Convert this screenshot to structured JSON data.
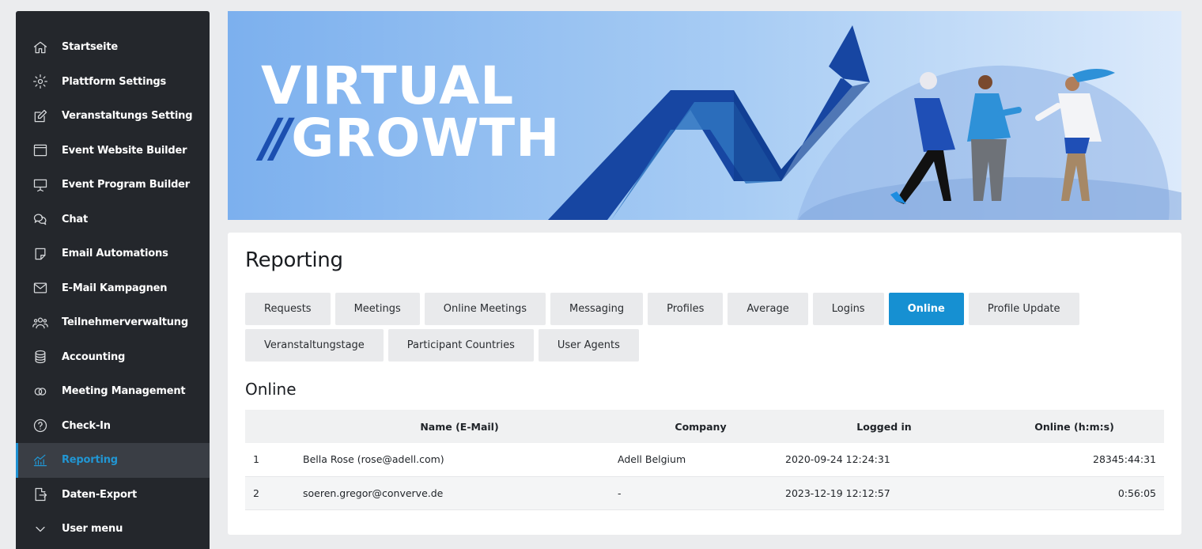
{
  "sidebar": {
    "items": [
      {
        "label": "Startseite",
        "icon": "home-icon"
      },
      {
        "label": "Plattform Settings",
        "icon": "gear-icon"
      },
      {
        "label": "Veranstaltungs Setting",
        "icon": "edit-icon"
      },
      {
        "label": "Event Website Builder",
        "icon": "browser-window-icon"
      },
      {
        "label": "Event Program Builder",
        "icon": "presentation-icon"
      },
      {
        "label": "Chat",
        "icon": "chat-bubbles-icon"
      },
      {
        "label": "Email Automations",
        "icon": "note-icon"
      },
      {
        "label": "E-Mail Kampagnen",
        "icon": "envelope-icon"
      },
      {
        "label": "Teilnehmerverwaltung",
        "icon": "users-icon"
      },
      {
        "label": "Accounting",
        "icon": "coins-icon"
      },
      {
        "label": "Meeting Management",
        "icon": "rings-icon"
      },
      {
        "label": "Check-In",
        "icon": "question-circle-icon"
      },
      {
        "label": "Reporting",
        "icon": "chart-icon",
        "active": true
      },
      {
        "label": "Daten-Export",
        "icon": "export-icon"
      },
      {
        "label": "User menu",
        "icon": "chevron-down-icon"
      }
    ]
  },
  "banner": {
    "line1": "VIRTUAL",
    "slash": "//",
    "line2": "GROWTH"
  },
  "main": {
    "title": "Reporting",
    "tabs_row1": [
      "Requests",
      "Meetings",
      "Online Meetings",
      "Messaging",
      "Profiles",
      "Average",
      "Logins",
      "Online",
      "Profile Update"
    ],
    "tabs_row2": [
      "Veranstaltungstage",
      "Participant Countries",
      "User Agents"
    ],
    "active_tab": "Online",
    "section_title": "Online",
    "table": {
      "headers": [
        "Name (E-Mail)",
        "Company",
        "Logged in",
        "Online (h:m:s)"
      ],
      "rows": [
        [
          "1",
          "Bella Rose (rose@adell.com)",
          "Adell Belgium",
          "2020-09-24 12:24:31",
          "28345:44:31"
        ],
        [
          "2",
          "soeren.gregor@converve.de",
          "-",
          "2023-12-19 12:12:57",
          "0:56:05"
        ]
      ]
    }
  },
  "colors": {
    "sidebar_bg": "#24272c",
    "accent": "#1690d2",
    "page_bg": "#ebecee"
  }
}
